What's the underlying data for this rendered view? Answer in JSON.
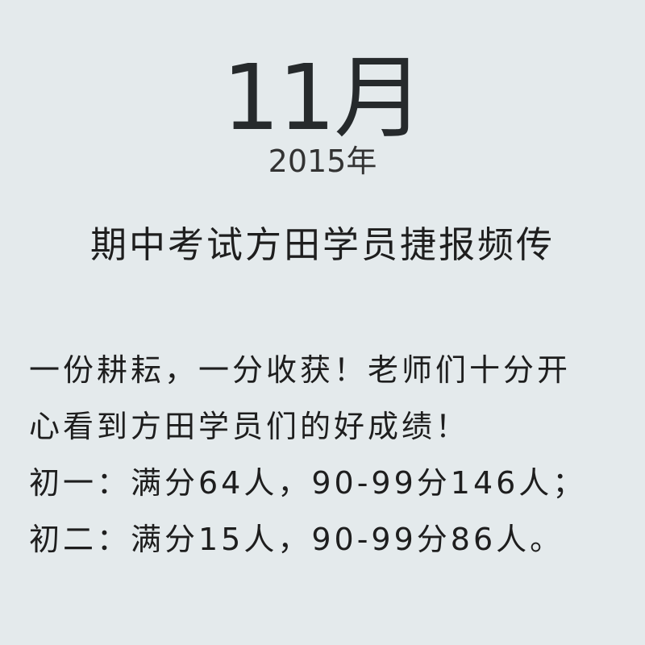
{
  "header": {
    "month": "11月",
    "year": "2015年"
  },
  "headline": "期中考试方田学员捷报频传",
  "body": {
    "lines": [
      "一份耕耘，一分收获！老师们十分开",
      "心看到方田学员们的好成绩！",
      "初一：满分64人，90-99分146人；",
      "初二：满分15人，90-99分86人。"
    ]
  },
  "colors": {
    "background": "#e4eaec",
    "text": "#1e1e1e"
  }
}
